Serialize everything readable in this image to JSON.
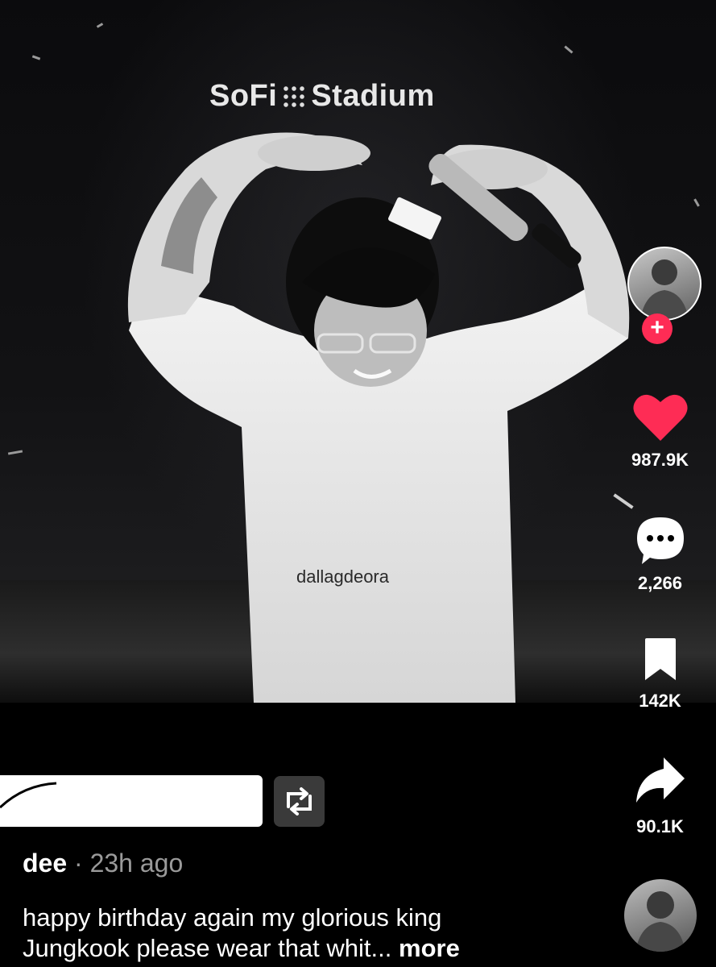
{
  "video": {
    "venue_sign": {
      "left": "SoFi",
      "right": "Stadium"
    },
    "watermark": "dallagdeora"
  },
  "sidebar": {
    "like_count": "987.9K",
    "comment_count": "2,266",
    "bookmark_count": "142K",
    "share_count": "90.1K",
    "follow_symbol": "+"
  },
  "post": {
    "author": "dee",
    "separator": "·",
    "time": "23h ago",
    "caption_line1": "happy birthday again my glorious king",
    "caption_line2": "Jungkook please wear that whit...",
    "more_label": "more"
  },
  "colors": {
    "like": "#fe2c55",
    "follow_badge": "#fe2c55",
    "background": "#000000",
    "muted_text": "#9a9a9a"
  },
  "icons": [
    "heart-icon",
    "comment-icon",
    "bookmark-icon",
    "share-icon",
    "repost-icon",
    "plus-icon"
  ]
}
